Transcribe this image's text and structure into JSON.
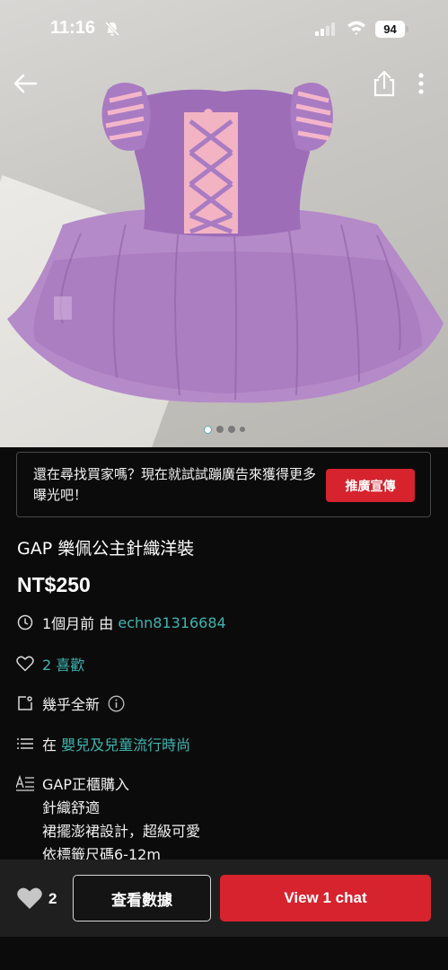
{
  "status_bar": {
    "time": "11:16",
    "battery": "94",
    "icons": [
      "bell-slash-icon",
      "signal-icon",
      "wifi-icon",
      "battery-icon"
    ]
  },
  "photo": {
    "description_icon": "product-photo",
    "carousel_count": 4,
    "carousel_active": 0
  },
  "nav": {
    "icons": [
      "back-arrow-icon",
      "share-icon",
      "more-vertical-icon"
    ]
  },
  "promo": {
    "text": "還在尋找買家嗎？現在就試試蹦廣告來獲得更多曝光吧！",
    "button": "推廣宣傳"
  },
  "listing": {
    "title": "GAP 樂佩公主針織洋裝",
    "price": "NT$250",
    "time_prefix": "1個月前 由 ",
    "seller": "echn81316684",
    "likes": "2 喜歡",
    "condition": "幾乎全新",
    "category_prefix": "在 ",
    "category": "嬰兒及兒童流行時尚",
    "description": [
      "GAP正櫃購入",
      "針織舒適",
      "裙擺澎裙設計，超級可愛",
      "依標籤尺碼6-12m"
    ]
  },
  "bottom_bar": {
    "like_count": "2",
    "stats_button": "查看數據",
    "chat_button": "View 1 chat"
  },
  "colors": {
    "accent_red": "#d6232e",
    "link_teal": "#3fb4b0",
    "background": "#0b0b0b"
  }
}
